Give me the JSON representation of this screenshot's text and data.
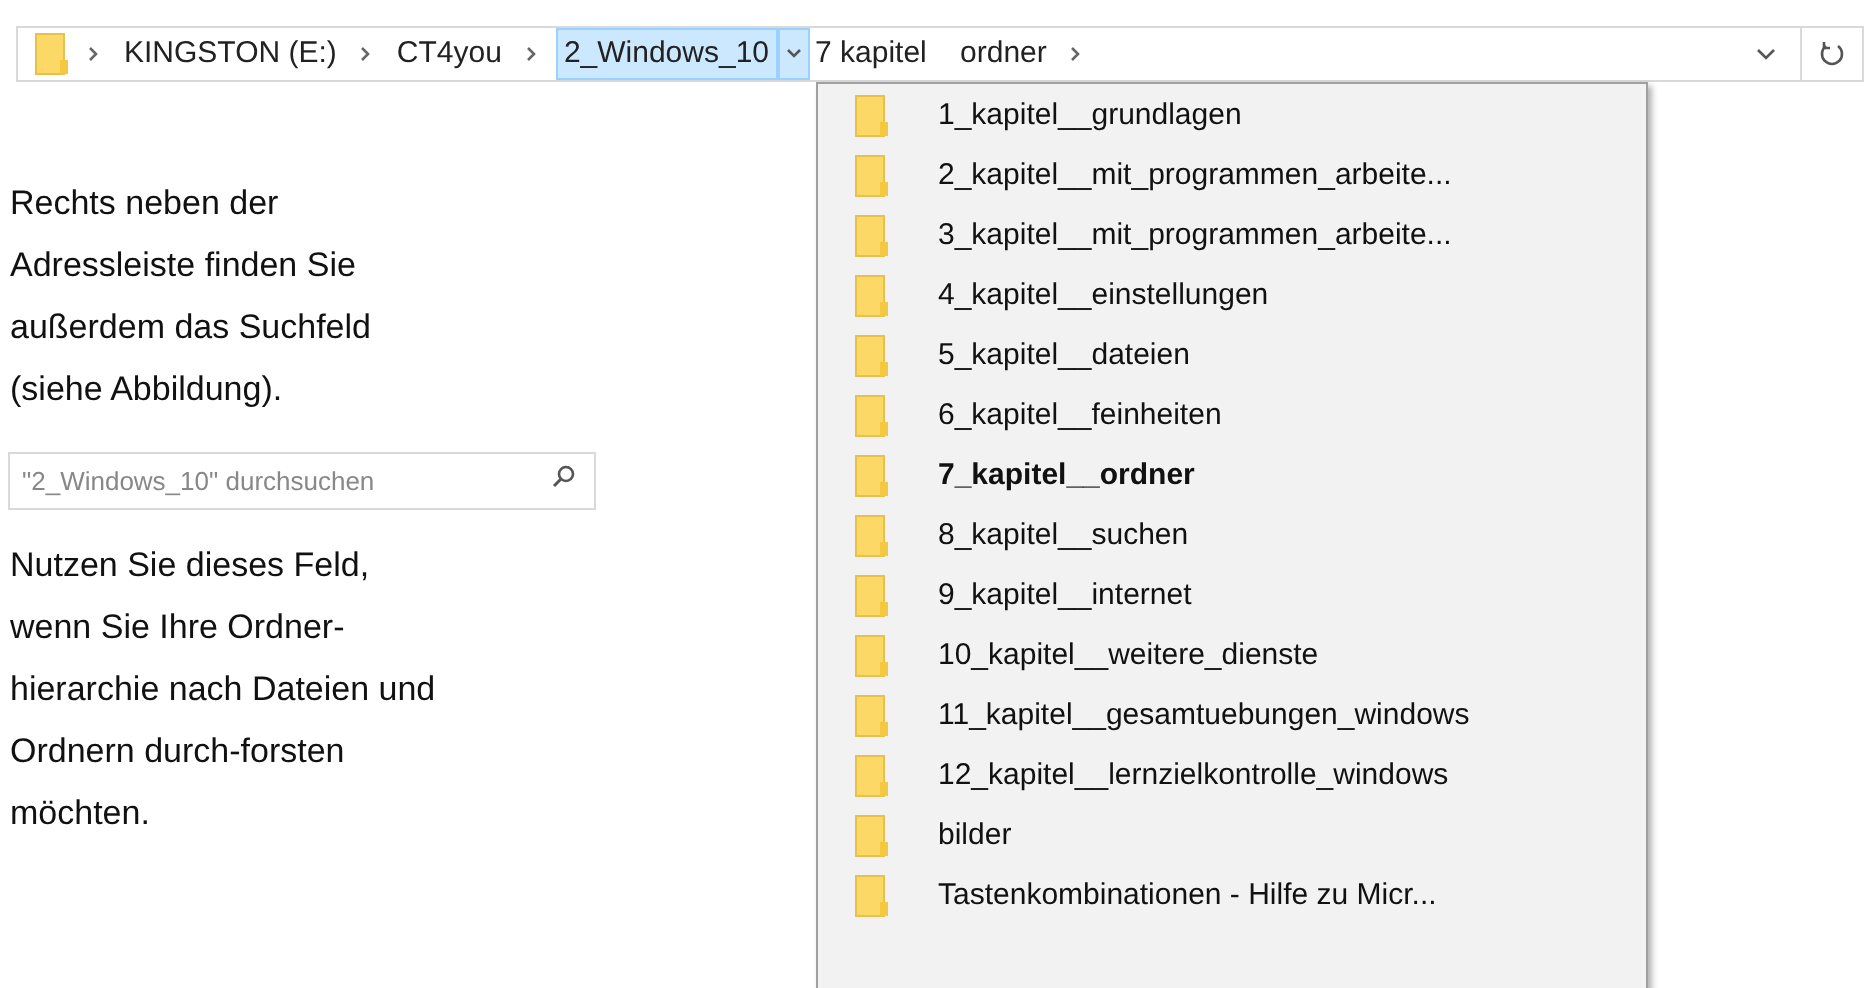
{
  "address_bar": {
    "crumbs": [
      {
        "label": "KINGSTON (E:)",
        "selected": false
      },
      {
        "label": "CT4you",
        "selected": false
      },
      {
        "label": "2_Windows_10",
        "selected": true
      },
      {
        "label": "7 kapitel    ordner",
        "selected": false
      }
    ]
  },
  "paragraph_1": "Rechts neben der Adressleiste finden Sie außerdem das Suchfeld (siehe Abbildung).",
  "search": {
    "placeholder": "\"2_Windows_10\" durchsuchen"
  },
  "paragraph_2": "Nutzen Sie dieses Feld, wenn Sie Ihre Ordner-hierarchie nach Dateien und Ordnern durch-forsten möchten.",
  "menu": {
    "items": [
      {
        "label": "1_kapitel__grundlagen",
        "selected": false
      },
      {
        "label": "2_kapitel__mit_programmen_arbeite...",
        "selected": false
      },
      {
        "label": "3_kapitel__mit_programmen_arbeite...",
        "selected": false
      },
      {
        "label": "4_kapitel__einstellungen",
        "selected": false
      },
      {
        "label": "5_kapitel__dateien",
        "selected": false
      },
      {
        "label": "6_kapitel__feinheiten",
        "selected": false
      },
      {
        "label": "7_kapitel__ordner",
        "selected": true
      },
      {
        "label": "8_kapitel__suchen",
        "selected": false
      },
      {
        "label": "9_kapitel__internet",
        "selected": false
      },
      {
        "label": "10_kapitel__weitere_dienste",
        "selected": false
      },
      {
        "label": "11_kapitel__gesamtuebungen_windows",
        "selected": false
      },
      {
        "label": "12_kapitel__lernzielkontrolle_windows",
        "selected": false
      },
      {
        "label": "bilder",
        "selected": false
      },
      {
        "label": "Tastenkombinationen - Hilfe zu Micr...",
        "selected": false
      }
    ]
  }
}
